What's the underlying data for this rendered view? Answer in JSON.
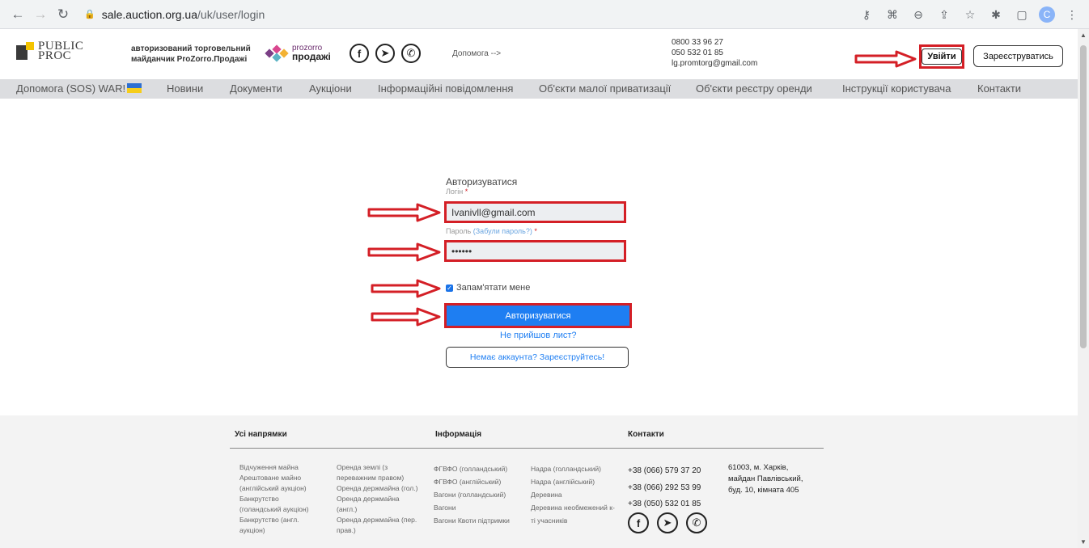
{
  "browser": {
    "url_host": "sale.auction.org.ua",
    "url_path": "/uk/user/login",
    "profile_initial": "C"
  },
  "header": {
    "logo_line1": "PUBLIC",
    "logo_line2": "PROC",
    "tagline_line1": "авторизований торговельний",
    "tagline_line2": "майданчик ProZorro.Продажі",
    "prozorro_line1": "prozorro",
    "prozorro_line2": "продажі",
    "help_link": "Допомога  -->",
    "phone1": "0800 33 96 27",
    "phone2": "050 532 01 85",
    "email": "lg.promtorg@gmail.com",
    "login_button": "Увійти",
    "register_button": "Зареєструватись"
  },
  "menu": {
    "items": [
      "Допомога (SOS) WAR!",
      "Новини",
      "Документи",
      "Аукціони",
      "Інформаційні повідомлення",
      "Об'єкти малої приватизації",
      "Об'єкти реєстру оренди",
      "Інструкції користувача",
      "Контакти"
    ]
  },
  "login_form": {
    "title": "Авторизуватися",
    "login_label": "Логін",
    "login_value": "Ivanivll@gmail.com",
    "password_label": "Пароль",
    "forgot_link": "(Забули пароль?)",
    "password_value": "••••••",
    "remember_label": "Запам'ятати мене",
    "submit_button": "Авторизуватися",
    "no_mail_link": "Не прийшов лист?",
    "no_account_button": "Немає аккаунта? Зареєструйтесь!"
  },
  "footer": {
    "col1_title": "Усі напрямки",
    "col2_title": "Інформація",
    "col3_title": "Контакти",
    "list_a": [
      "Відчуження майна",
      "Арештоване майно",
      "(англійський аукціон)",
      "Банкрутство",
      "(голандський аукціон)",
      "Банкрутство (англ.",
      "аукціон)"
    ],
    "list_b": [
      "Оренда землі (з",
      "переважним правом)",
      "Оренда держмайна (гол.)",
      "Оренда держмайна",
      "(англ.)",
      "Оренда держмайна (пер.",
      "прав.)"
    ],
    "list_c": [
      "ФГВФО (голландський)",
      "ФГВФО (англійський)",
      "Вагони (голландський)",
      "Вагони",
      "Вагони Квоти підтримки"
    ],
    "list_d": [
      "Надра (голландський)",
      "Надра (англійський)",
      "Деревина",
      "Деревина необмежений к-",
      "ті учасників"
    ],
    "phones": [
      "+38 (066) 579 37 20",
      "+38 (066) 292 53 99",
      "+38 (050) 532 01 85"
    ],
    "address_line1": "61003, м. Харків,",
    "address_line2": "майдан Павлівський,",
    "address_line3": "буд. 10, кімната 405"
  },
  "colors": {
    "highlight_red": "#d41f26",
    "primary_blue": "#1e7ef2",
    "menu_bg": "#dcdde0",
    "logo_yellow": "#f4c400"
  }
}
